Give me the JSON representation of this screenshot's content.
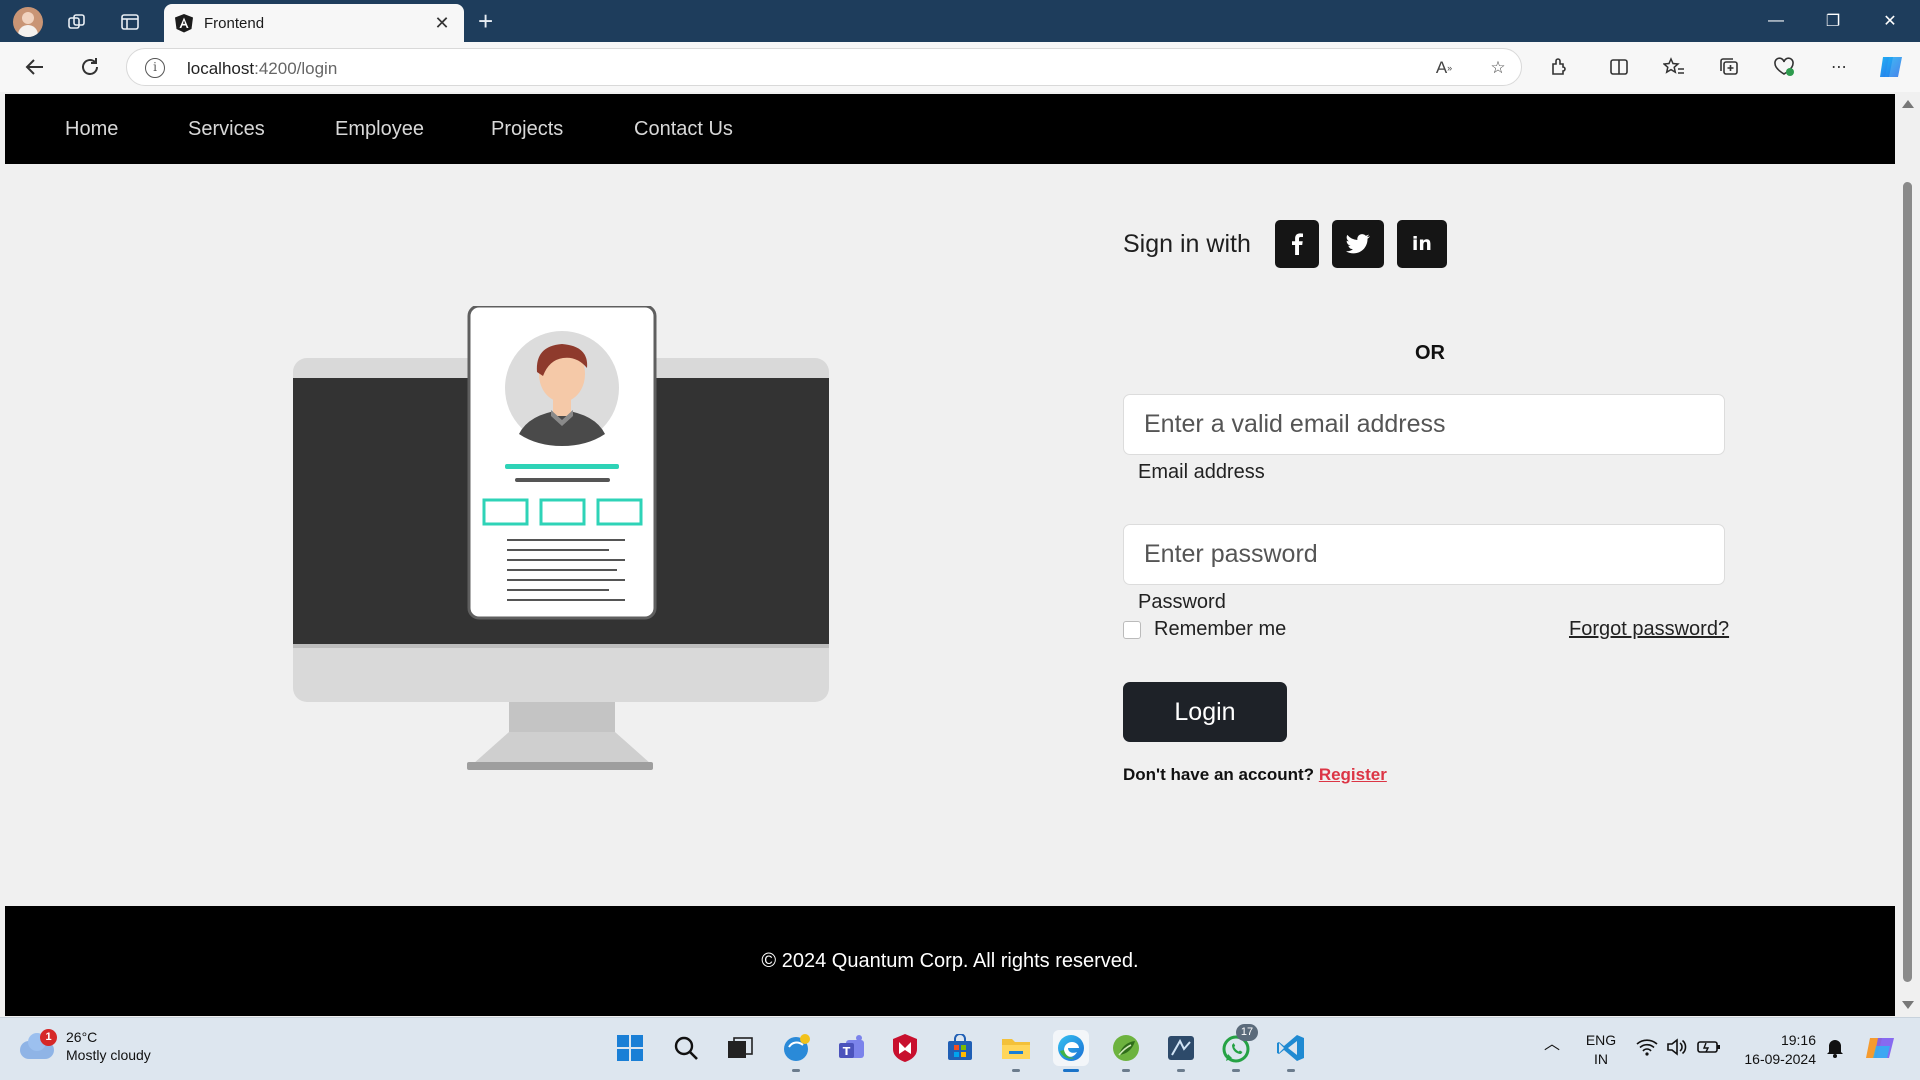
{
  "browser": {
    "tab_title": "Frontend",
    "url_host": "localhost",
    "url_rest": ":4200/login"
  },
  "nav": {
    "items": [
      "Home",
      "Services",
      "Employee",
      "Projects",
      "Contact Us"
    ]
  },
  "form": {
    "signin_label": "Sign in with",
    "social": [
      "f",
      "t",
      "in"
    ],
    "or_label": "OR",
    "email_placeholder": "Enter a valid email address",
    "email_label": "Email address",
    "password_placeholder": "Enter password",
    "password_label": "Password",
    "remember_label": "Remember me",
    "forgot_label": "Forgot password?",
    "login_label": "Login",
    "no_account_text": "Don't have an account?",
    "register_label": "Register"
  },
  "footer": {
    "text": "© 2024 Quantum Corp. All rights reserved."
  },
  "taskbar": {
    "weather_temp": "26°C",
    "weather_desc": "Mostly cloudy",
    "weather_badge": "1",
    "whatsapp_badge": "17",
    "lang_line1": "ENG",
    "lang_line2": "IN",
    "time": "19:16",
    "date": "16-09-2024"
  },
  "colors": {
    "nav_bg": "#000000",
    "login_button": "#1e2228",
    "register_link": "#dc3545",
    "accent_teal": "#2ed3b7"
  }
}
